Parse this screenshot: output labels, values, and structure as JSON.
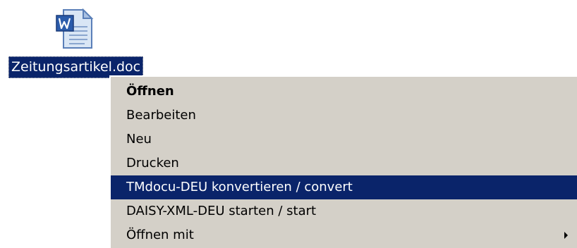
{
  "desktop": {
    "file": {
      "name": "Zeitungsartikel.doc",
      "icon": "word-document-icon"
    }
  },
  "context_menu": {
    "items": [
      {
        "label": "Öffnen",
        "default": true
      },
      {
        "label": "Bearbeiten"
      },
      {
        "label": "Neu"
      },
      {
        "label": "Drucken"
      },
      {
        "label": "TMdocu-DEU konvertieren / convert",
        "highlighted": true
      },
      {
        "label": "DAISY-XML-DEU starten / start"
      },
      {
        "label": "Öffnen mit",
        "submenu": true,
        "submenu_icon": "chevron-right-icon"
      }
    ]
  },
  "colors": {
    "selection": "#0a246a",
    "menu_background": "#d4d0c8",
    "selection_text": "#ffffff"
  }
}
